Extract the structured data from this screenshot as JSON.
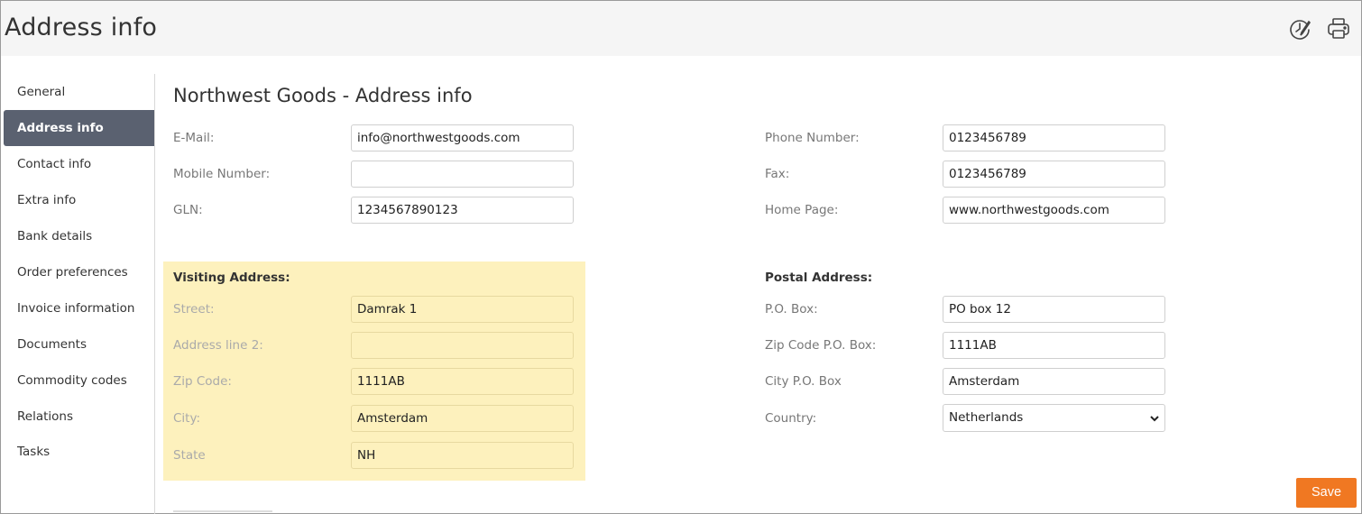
{
  "header": {
    "title": "Address info",
    "icons": [
      "clock-edit-icon",
      "printer-icon"
    ]
  },
  "sidebar": {
    "items": [
      {
        "label": "General",
        "active": false
      },
      {
        "label": "Address info",
        "active": true
      },
      {
        "label": "Contact info",
        "active": false
      },
      {
        "label": "Extra info",
        "active": false
      },
      {
        "label": "Bank details",
        "active": false
      },
      {
        "label": "Order preferences",
        "active": false
      },
      {
        "label": "Invoice information",
        "active": false
      },
      {
        "label": "Documents",
        "active": false
      },
      {
        "label": "Commodity codes",
        "active": false
      },
      {
        "label": "Relations",
        "active": false
      },
      {
        "label": "Tasks",
        "active": false
      }
    ]
  },
  "main": {
    "title": "Northwest Goods - Address info",
    "contact": {
      "email": {
        "label": "E-Mail:",
        "value": "info@northwestgoods.com"
      },
      "mobile": {
        "label": "Mobile Number:",
        "value": ""
      },
      "gln": {
        "label": "GLN:",
        "value": "1234567890123"
      },
      "phone": {
        "label": "Phone Number:",
        "value": "0123456789"
      },
      "fax": {
        "label": "Fax:",
        "value": "0123456789"
      },
      "homepage": {
        "label": "Home Page:",
        "value": "www.northwestgoods.com"
      }
    },
    "visiting": {
      "heading": "Visiting Address:",
      "street": {
        "label": "Street:",
        "value": "Damrak 1"
      },
      "line2": {
        "label": "Address line 2:",
        "value": ""
      },
      "zip": {
        "label": "Zip Code:",
        "value": "1111AB"
      },
      "city": {
        "label": "City:",
        "value": "Amsterdam"
      },
      "state": {
        "label": "State",
        "value": "NH"
      }
    },
    "postal": {
      "heading": "Postal Address:",
      "pobox": {
        "label": "P.O. Box:",
        "value": "PO box 12"
      },
      "zip": {
        "label": "Zip Code P.O. Box:",
        "value": "1111AB"
      },
      "city": {
        "label": "City P.O. Box",
        "value": "Amsterdam"
      },
      "country": {
        "label": "Country:",
        "value": "Netherlands"
      }
    },
    "save_label": "Save"
  },
  "colors": {
    "accent": "#f07822",
    "sidebar_active": "#5a6170",
    "highlight": "#fdf1bd"
  }
}
